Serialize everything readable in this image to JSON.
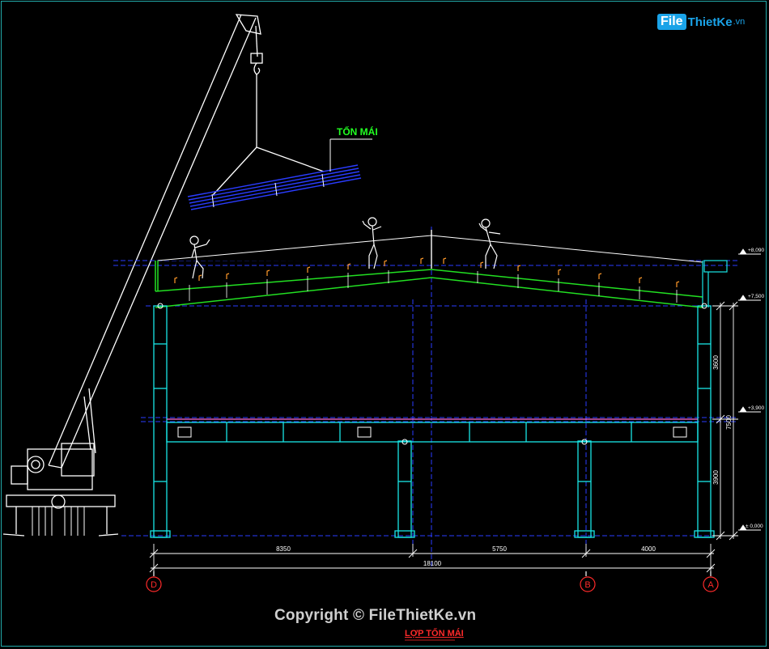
{
  "logo": {
    "file": "File",
    "rest": "ThietKe",
    "domain": ".vn"
  },
  "labels": {
    "ton_mai": "TỐN MÁI",
    "title": "LỢP TỐN MÁI",
    "watermark": "Copyright © FileThietKe.vn"
  },
  "elevations": [
    "+8,090",
    "+7,500",
    "+3,900",
    "± 0,000"
  ],
  "vertical_dims": [
    "3600",
    "7500",
    "3900"
  ],
  "horizontal_dims": {
    "seg1": "8350",
    "seg2": "5750",
    "seg3": "4000",
    "total": "18100"
  },
  "axes": [
    "D",
    "B",
    "A"
  ],
  "colors": {
    "cad_cyan": "#19e6e6",
    "cad_green": "#22e022",
    "cad_blue": "#2a3cff",
    "cad_red": "#ff2a2a",
    "cad_white": "#ffffff"
  }
}
